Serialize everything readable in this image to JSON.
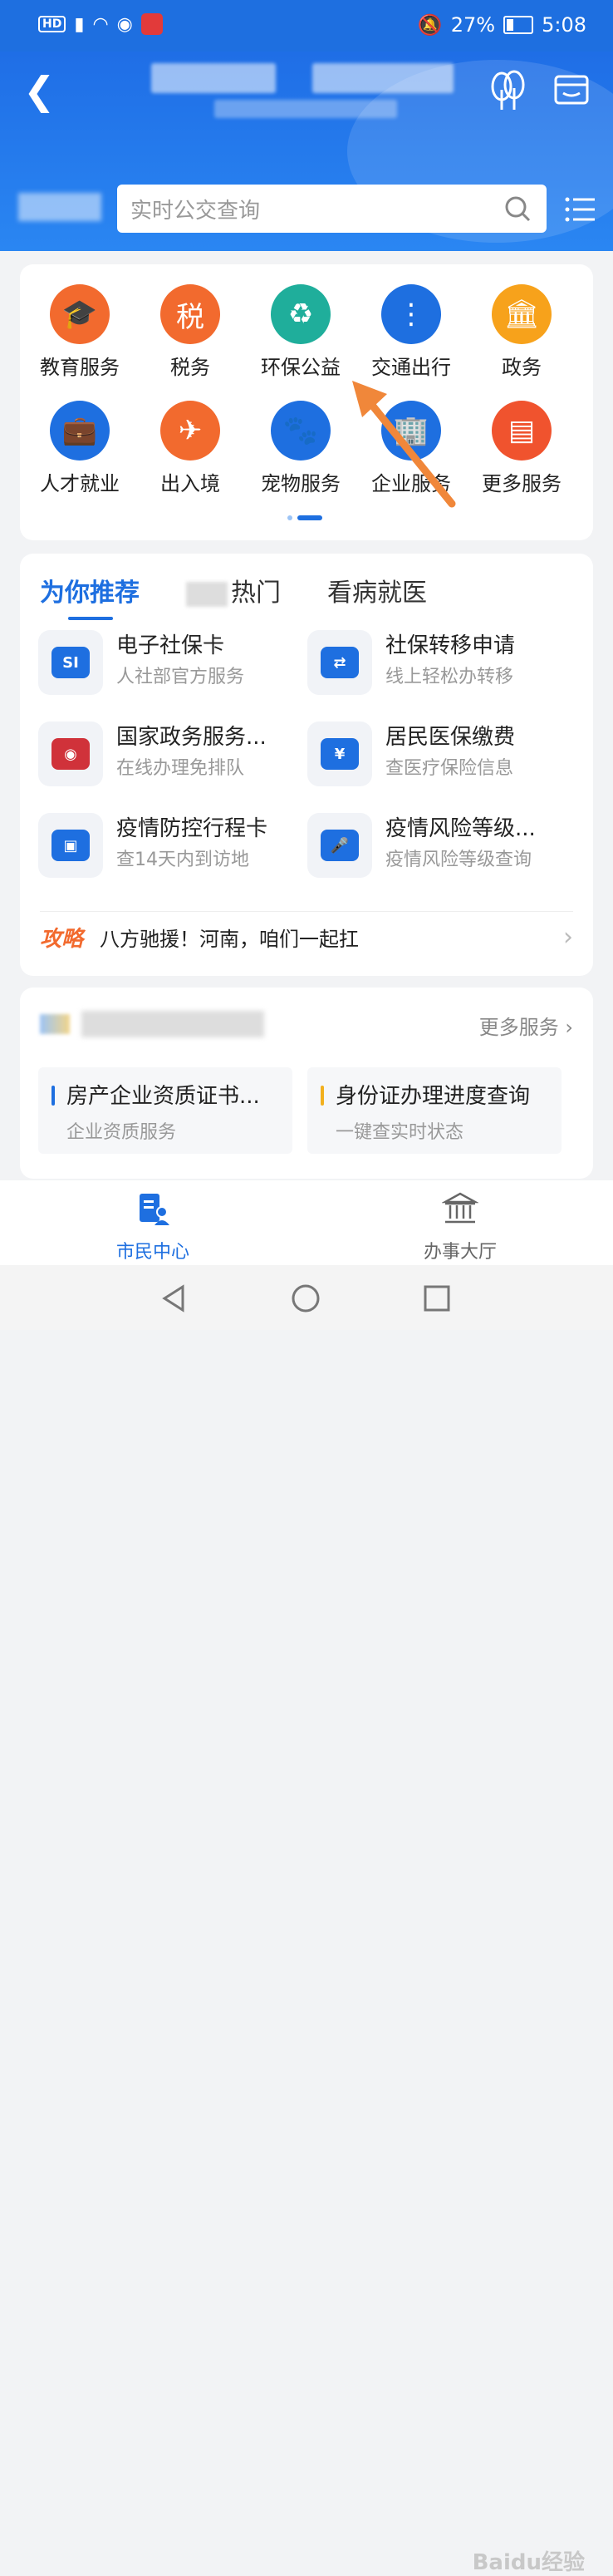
{
  "status": {
    "battery": "27%",
    "time": "5:08"
  },
  "search": {
    "placeholder": "实时公交查询"
  },
  "grid": {
    "items": [
      {
        "label": "教育服务",
        "icon": "graduation-cap-icon",
        "color": "#f26a2e"
      },
      {
        "label": "税务",
        "icon": "tax-icon",
        "color": "#f26a2e"
      },
      {
        "label": "环保公益",
        "icon": "recycle-icon",
        "color": "#1fae9b"
      },
      {
        "label": "交通出行",
        "icon": "traffic-light-icon",
        "color": "#1e6fe0"
      },
      {
        "label": "政务",
        "icon": "government-building-icon",
        "color": "#f7a21b"
      },
      {
        "label": "人才就业",
        "icon": "briefcase-icon",
        "color": "#1e6fe0"
      },
      {
        "label": "出入境",
        "icon": "airplane-icon",
        "color": "#f26a2e"
      },
      {
        "label": "宠物服务",
        "icon": "pet-icon",
        "color": "#1e6fe0"
      },
      {
        "label": "企业服务",
        "icon": "building-icon",
        "color": "#1e6fe0"
      },
      {
        "label": "更多服务",
        "icon": "box-icon",
        "color": "#f0532e"
      }
    ]
  },
  "tabs": [
    "为你推荐",
    "热门",
    "看病就医"
  ],
  "recommend": {
    "items": [
      {
        "title": "电子社保卡",
        "subtitle": "人社部官方服务",
        "icon": "social-security-card-icon"
      },
      {
        "title": "社保转移申请",
        "subtitle": "线上轻松办转移",
        "icon": "transfer-search-icon"
      },
      {
        "title": "国家政务服务...",
        "subtitle": "在线办理免排队",
        "icon": "national-emblem-icon"
      },
      {
        "title": "居民医保缴费",
        "subtitle": "查医疗保险信息",
        "icon": "medical-insurance-icon"
      },
      {
        "title": "疫情防控行程卡",
        "subtitle": "查14天内到访地",
        "icon": "travel-card-icon"
      },
      {
        "title": "疫情风险等级...",
        "subtitle": "疫情风险等级查询",
        "icon": "microphone-icon"
      }
    ],
    "guide_tag": "攻略",
    "guide_text": "八方驰援！河南，咱们一起扛"
  },
  "more_card": {
    "more_label": "更多服务",
    "tiles": [
      {
        "title": "房产企业资质证书...",
        "subtitle": "企业资质服务",
        "bar_color": "#1e6fe0"
      },
      {
        "title": "身份证办理进度查询",
        "subtitle": "一键查实时状态",
        "bar_color": "#f2b01e"
      }
    ]
  },
  "bottom_nav": [
    {
      "label": "市民中心",
      "active": true
    },
    {
      "label": "办事大厅",
      "active": false
    }
  ],
  "watermark": "Baidu经验"
}
